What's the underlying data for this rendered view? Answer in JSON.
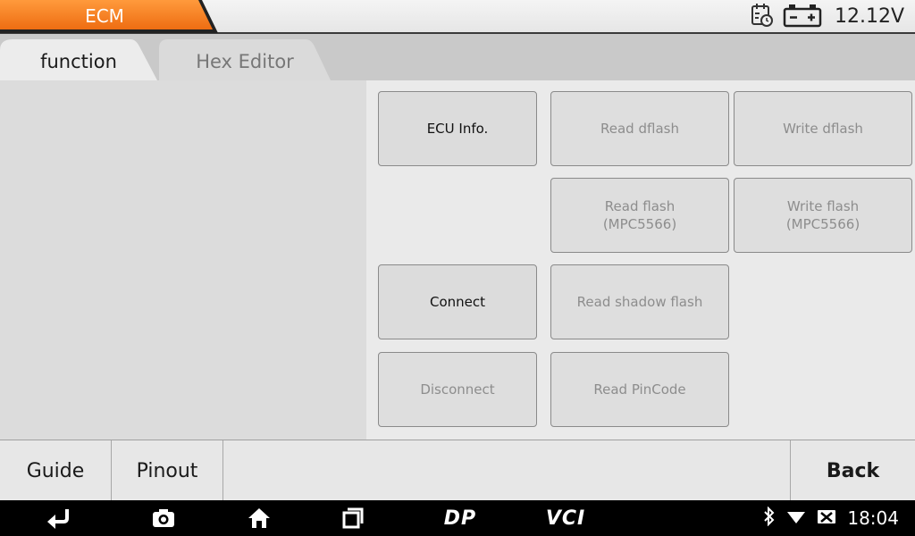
{
  "header": {
    "module_title": "ECM",
    "voltage": "12.12V",
    "accent_color": "#f47b1f"
  },
  "tabs": [
    {
      "label": "function",
      "active": true
    },
    {
      "label": "Hex Editor",
      "active": false
    }
  ],
  "functions": {
    "ecu_info": {
      "label": "ECU Info.",
      "enabled": true
    },
    "read_dflash": {
      "label": "Read dflash",
      "enabled": false
    },
    "write_dflash": {
      "label": "Write dflash",
      "enabled": false
    },
    "read_flash": {
      "label": "Read flash\n(MPC5566)",
      "enabled": false
    },
    "write_flash": {
      "label": "Write flash\n(MPC5566)",
      "enabled": false
    },
    "connect": {
      "label": "Connect",
      "enabled": true
    },
    "read_shadow_flash": {
      "label": "Read shadow flash",
      "enabled": false
    },
    "disconnect": {
      "label": "Disconnect",
      "enabled": false
    },
    "read_pincode": {
      "label": "Read PinCode",
      "enabled": false
    }
  },
  "bottom": {
    "guide": "Guide",
    "pinout": "Pinout",
    "back": "Back"
  },
  "navbar": {
    "icons": [
      "back-arrow-icon",
      "camera-icon",
      "home-icon",
      "recents-icon"
    ],
    "dp_label": "DP",
    "vci_label": "VCI",
    "status_icons": [
      "bluetooth-icon",
      "wifi-icon",
      "no-sim-icon"
    ],
    "clock": "18:04"
  }
}
